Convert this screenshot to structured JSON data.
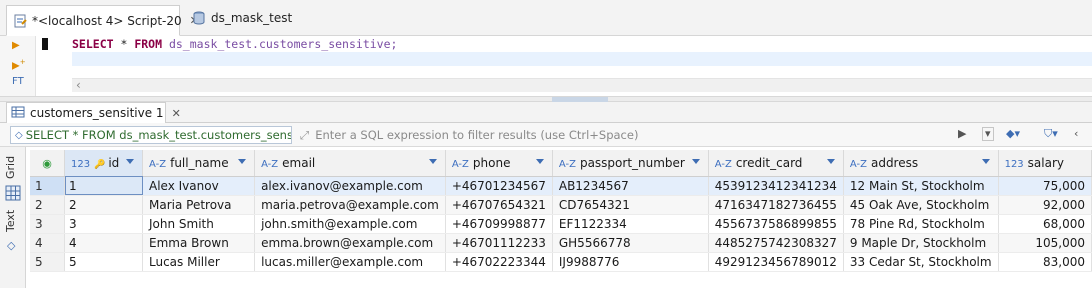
{
  "editor_tabs": [
    {
      "label": "*<localhost 4> Script-20",
      "active": true
    },
    {
      "label": "ds_mask_test",
      "active": false
    }
  ],
  "editor": {
    "sql_keyword1": "SELECT",
    "sql_star": " * ",
    "sql_keyword2": "FROM",
    "sql_table": " ds_mask_test.customers_sensitive;"
  },
  "results_tab": {
    "label": "customers_sensitive 1"
  },
  "filter": {
    "query": "SELECT * FROM ds_mask_test.customers_sensitive",
    "placeholder": "Enter a SQL expression to filter results (use Ctrl+Space)"
  },
  "side_tabs": [
    "Grid",
    "Text"
  ],
  "grid": {
    "columns": [
      {
        "type": "123",
        "name": "id"
      },
      {
        "type": "A-Z",
        "name": "full_name"
      },
      {
        "type": "A-Z",
        "name": "email"
      },
      {
        "type": "A-Z",
        "name": "phone"
      },
      {
        "type": "A-Z",
        "name": "passport_number"
      },
      {
        "type": "A-Z",
        "name": "credit_card"
      },
      {
        "type": "A-Z",
        "name": "address"
      },
      {
        "type": "123",
        "name": "salary"
      }
    ],
    "rows": [
      {
        "n": "1",
        "id": "1",
        "full_name": "Alex Ivanov",
        "email": "alex.ivanov@example.com",
        "phone": "+46701234567",
        "passport": "AB1234567",
        "card": "4539123412341234",
        "address": "12 Main St, Stockholm",
        "salary": "75,000"
      },
      {
        "n": "2",
        "id": "2",
        "full_name": "Maria Petrova",
        "email": "maria.petrova@example.com",
        "phone": "+46707654321",
        "passport": "CD7654321",
        "card": "4716347182736455",
        "address": "45 Oak Ave, Stockholm",
        "salary": "92,000"
      },
      {
        "n": "3",
        "id": "3",
        "full_name": "John Smith",
        "email": "john.smith@example.com",
        "phone": "+46709998877",
        "passport": "EF1122334",
        "card": "4556737586899855",
        "address": "78 Pine Rd, Stockholm",
        "salary": "68,000"
      },
      {
        "n": "4",
        "id": "4",
        "full_name": "Emma Brown",
        "email": "emma.brown@example.com",
        "phone": "+46701112233",
        "passport": "GH5566778",
        "card": "4485275742308327",
        "address": "9 Maple Dr, Stockholm",
        "salary": "105,000"
      },
      {
        "n": "5",
        "id": "5",
        "full_name": "Lucas Miller",
        "email": "lucas.miller@example.com",
        "phone": "+46702223344",
        "passport": "IJ9988776",
        "card": "4929123456789012",
        "address": "33 Cedar St, Stockholm",
        "salary": "83,000"
      }
    ]
  },
  "colors": {
    "accent": "#3e6db3",
    "keyword": "#8b0046",
    "table_name": "#7a4da3"
  }
}
